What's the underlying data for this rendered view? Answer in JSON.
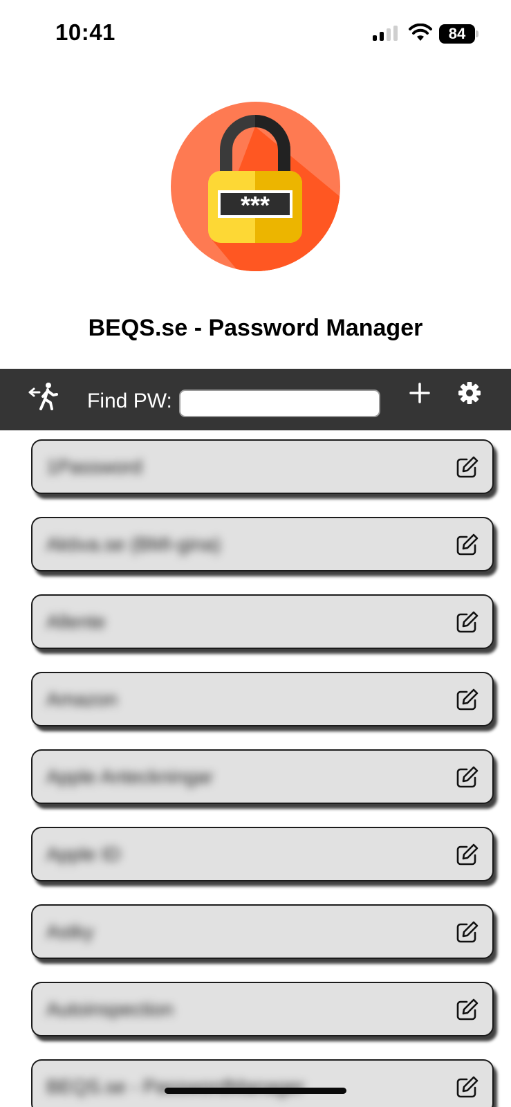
{
  "status_bar": {
    "time": "10:41",
    "battery": "84",
    "icons": [
      "signal-icon",
      "wifi-icon",
      "battery-icon"
    ]
  },
  "header": {
    "logo": "padlock-logo",
    "logo_text": "***",
    "title": "BEQS.se - Password Manager"
  },
  "toolbar": {
    "find_label": "Find PW:",
    "search_value": "",
    "search_placeholder": "",
    "icons": [
      "logout-icon",
      "add-icon",
      "settings-icon"
    ]
  },
  "password_entries": [
    {
      "name": "1Password"
    },
    {
      "name": "Aktiva.se (BMI-gina)"
    },
    {
      "name": "Allente"
    },
    {
      "name": "Amazon"
    },
    {
      "name": "Apple Anteckningar"
    },
    {
      "name": "Apple ID"
    },
    {
      "name": "Astky"
    },
    {
      "name": "Autoinspection"
    },
    {
      "name": "BEQS.se - PasswordManager"
    }
  ],
  "colors": {
    "toolbar_bg": "#353535",
    "item_bg": "#e1e1e1",
    "logo_circle": "#ff5722",
    "lock_body": "#fdd835"
  }
}
